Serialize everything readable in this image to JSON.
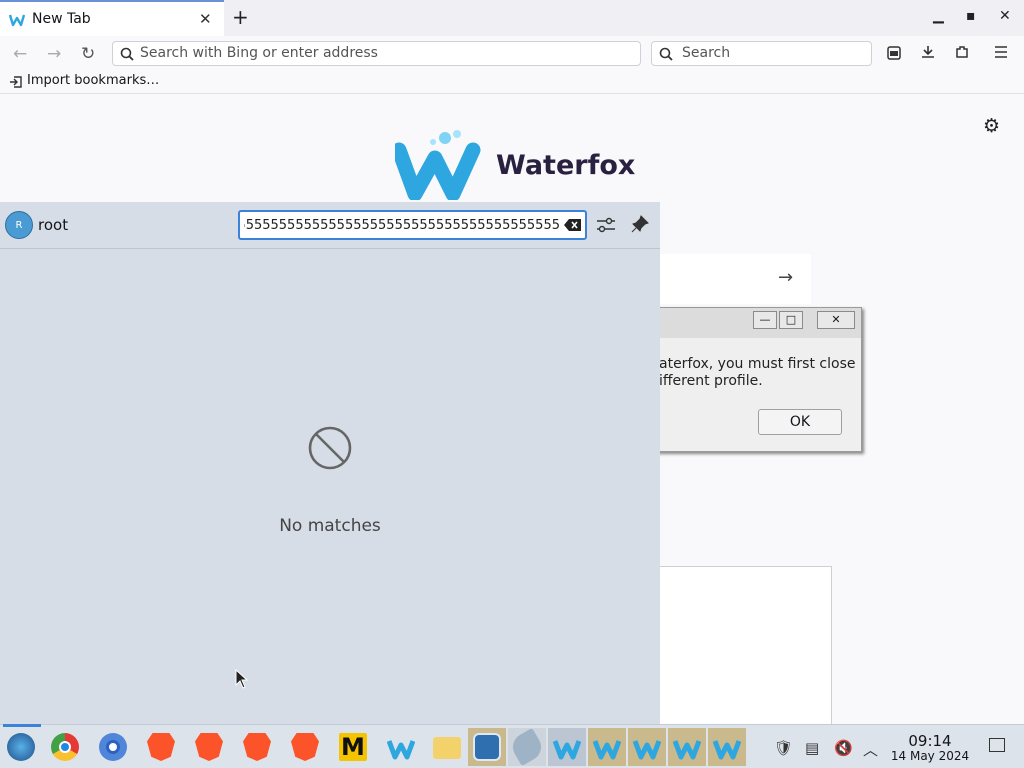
{
  "browser": {
    "tab_title": "New Tab",
    "new_tab_symbol": "+",
    "close_symbol": "✕",
    "window_controls": {
      "minimize": "▁",
      "maximize": "▪",
      "close": "✕"
    },
    "address_placeholder": "Search with Bing or enter address",
    "search_placeholder": "Search",
    "bookmark_import_label": "Import bookmarks…"
  },
  "newtab_page": {
    "brand_name": "Waterfox",
    "brand_colors": {
      "wordmark": "#2a2140",
      "logo_blue": "#2ea7e0"
    }
  },
  "dialog": {
    "message": "aterfox, you must first close\nifferent profile.",
    "ok_label": "OK"
  },
  "panel": {
    "user_initial": "R",
    "user_name": "root",
    "filter_value": "55555555555555555555555555555555555555555555555",
    "empty_text": "No matches",
    "accent": "#3b83d9"
  },
  "taskbar": {
    "icons": [
      "start-orb-icon",
      "chrome-icon",
      "chromium-icon",
      "brave-icon",
      "brave-icon",
      "brave-icon",
      "brave-icon",
      "m-app-icon",
      "waterfox-icon",
      "file-manager-icon",
      "terminal-icon",
      "network-tool-icon",
      "waterfox-icon",
      "waterfox-icon",
      "waterfox-icon",
      "waterfox-icon",
      "waterfox-icon"
    ],
    "time": "09:14",
    "date": "14 May 2024"
  }
}
